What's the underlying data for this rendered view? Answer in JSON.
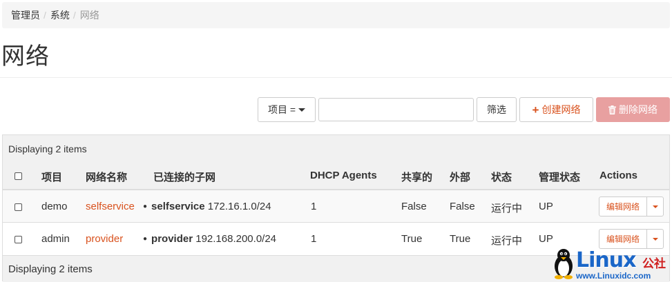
{
  "breadcrumb": {
    "items": [
      "管理员",
      "系统"
    ],
    "separator": "/",
    "current": "网络"
  },
  "page": {
    "title": "网络"
  },
  "toolbar": {
    "filter_select_label": "项目 =",
    "filter_value": "",
    "filter_button": "筛选",
    "create_button": "创建网络",
    "delete_button": "删除网络"
  },
  "table": {
    "count_text": "Displaying 2 items",
    "headers": {
      "project": "项目",
      "network_name": "网络名称",
      "subnets": "已连接的子网",
      "dhcp_agents": "DHCP Agents",
      "shared": "共享的",
      "external": "外部",
      "status": "状态",
      "admin_state": "管理状态",
      "actions": "Actions"
    },
    "rows": [
      {
        "project": "demo",
        "name": "selfservice",
        "subnet_name": "selfservice",
        "subnet_cidr": "172.16.1.0/24",
        "dhcp_agents": "1",
        "shared": "False",
        "external": "False",
        "status": "运行中",
        "admin_state": "UP",
        "action": "编辑网络"
      },
      {
        "project": "admin",
        "name": "provider",
        "subnet_name": "provider",
        "subnet_cidr": "192.168.200.0/24",
        "dhcp_agents": "1",
        "shared": "True",
        "external": "True",
        "status": "运行中",
        "admin_state": "UP",
        "action": "编辑网络"
      }
    ]
  },
  "watermark": {
    "brand": "Linux",
    "suffix": "公社",
    "url": "www.Linuxidc.com"
  },
  "colors": {
    "accent": "#d9521e",
    "danger_disabled": "#e8a0a0",
    "watermark_blue": "#1a66c8"
  }
}
